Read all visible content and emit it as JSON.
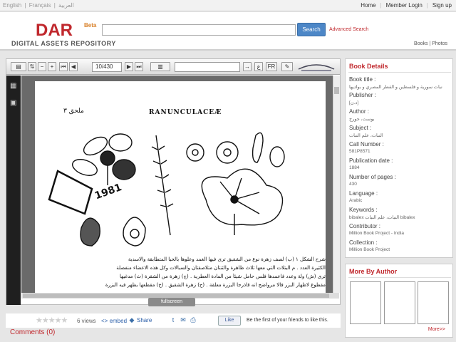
{
  "topbar": {
    "languages": [
      "English",
      "Français",
      "العربية"
    ],
    "links": [
      "Home",
      "Member Login",
      "Sign up"
    ]
  },
  "header": {
    "logo": "DAR",
    "beta": "Beta",
    "subtitle": "DIGITAL ASSETS REPOSITORY",
    "search_value": "",
    "search_button": "Search",
    "advanced_search": "Advanced Search",
    "right_links": "Books | Photos"
  },
  "viewer": {
    "toolbar": {
      "page_indicator": "10/430",
      "zoom_out": "−",
      "zoom_in": "+",
      "fr": "FR",
      "search_value": ""
    },
    "page": {
      "heading_latin": "RANUNCULACEÆ",
      "heading_arabic": "ملحق ٣",
      "stamp_number": "1981",
      "text_lines": [
        "شرح الشكل ١ (ب) لصف زهرة نوع من الشقيق ترى فيها الغمد وعلوها بالحيا المتطابقة والاسدية",
        "الكثيرة العدد . م البتلات التي معها ثلاث ظاهرة والثنتان متلاصقتان والسبالات وكل هذه الاعضاء منفصلة",
        "ترى (ش) ولة وعدد فاعمدها فلس حامل شيئاً من المادة العطرية . (ج) زهرة من الشقرة (ث) مدغيها",
        "مقطوع لاظهار البزر فالا مرواضح انه قاذرجا البزرة معلقة . (ح) زهرة الشقيق . (خ) مقطعها بظهر فيه البزرة"
      ]
    },
    "fullscreen_label": "fullscreen"
  },
  "social": {
    "views": "6 views",
    "embed": "<> embed",
    "share": "Share",
    "like": "Like",
    "like_text": "Be the first of your friends to like this."
  },
  "comments": "Comments (0)",
  "book_details": {
    "title": "Book Details",
    "fields": [
      {
        "label": "Book title :",
        "value": "نبات سورية و فلسطين و القطر المصري و بواديها"
      },
      {
        "label": "Publisher :",
        "value": "[د.ن]"
      },
      {
        "label": "Author :",
        "value": "بوست، جورج"
      },
      {
        "label": "Subject :",
        "value": "النبات، علم النبات"
      },
      {
        "label": "Call Number :",
        "value": "581P8571"
      },
      {
        "label": "Publication date :",
        "value": "1884"
      },
      {
        "label": "Number of pages :",
        "value": "430"
      },
      {
        "label": "Language :",
        "value": "Arabic"
      },
      {
        "label": "Keywords :",
        "value": "bibalex النبات، علم النبات bibalex"
      },
      {
        "label": "Contributor :",
        "value": "Million Book Project - India"
      },
      {
        "label": "Collection :",
        "value": "Million Book Project"
      }
    ]
  },
  "more_by_author": {
    "title": "More By Author",
    "more_link": "More>>"
  },
  "colors": {
    "accent_red": "#c0282d",
    "search_blue": "#4d87c7",
    "viewer_sidebar": "#1f1f1f"
  }
}
